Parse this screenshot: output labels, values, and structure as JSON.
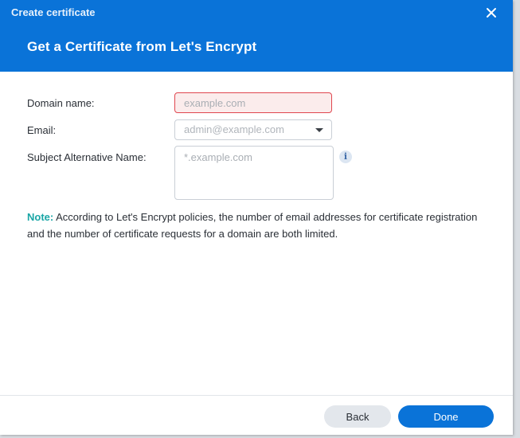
{
  "window": {
    "title": "Create certificate"
  },
  "header": {
    "title": "Get a Certificate from Let's Encrypt"
  },
  "form": {
    "domain_label": "Domain name:",
    "domain_placeholder": "example.com",
    "domain_value": "",
    "email_label": "Email:",
    "email_placeholder": "admin@example.com",
    "san_label": "Subject Alternative Name:",
    "san_placeholder": "*.example.com",
    "san_value": ""
  },
  "note": {
    "prefix": "Note:",
    "text": " According to Let's Encrypt policies, the number of email addresses for certificate registration and the number of certificate requests for a domain are both limited."
  },
  "footer": {
    "back_label": "Back",
    "done_label": "Done"
  },
  "icons": {
    "close": "close-icon",
    "info": "info-icon",
    "dropdown": "chevron-down-icon"
  },
  "colors": {
    "header_bg": "#0a73d8",
    "primary_button": "#0a73d8",
    "error_border": "#e0464f",
    "error_bg": "#fbecec",
    "note_prefix": "#1aa6a6"
  }
}
